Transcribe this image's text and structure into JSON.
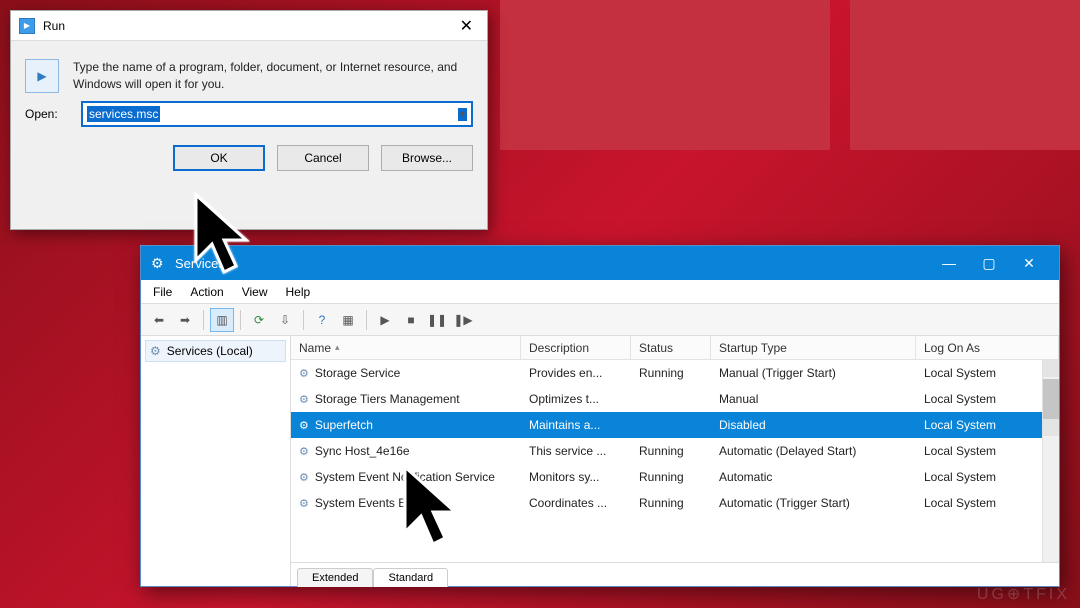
{
  "run": {
    "title": "Run",
    "instruction": "Type the name of a program, folder, document, or Internet resource, and Windows will open it for you.",
    "open_label": "Open:",
    "open_value": "services.msc",
    "ok": "OK",
    "cancel": "Cancel",
    "browse": "Browse..."
  },
  "services": {
    "title": "Services",
    "menu": {
      "file": "File",
      "action": "Action",
      "view": "View",
      "help": "Help"
    },
    "tree_root": "Services (Local)",
    "columns": {
      "name": "Name",
      "description": "Description",
      "status": "Status",
      "startup": "Startup Type",
      "logon": "Log On As"
    },
    "rows": [
      {
        "name": "Storage Service",
        "desc": "Provides en...",
        "status": "Running",
        "startup": "Manual (Trigger Start)",
        "logon": "Local System"
      },
      {
        "name": "Storage Tiers Management",
        "desc": "Optimizes t...",
        "status": "",
        "startup": "Manual",
        "logon": "Local System"
      },
      {
        "name": "Superfetch",
        "desc": "Maintains a...",
        "status": "",
        "startup": "Disabled",
        "logon": "Local System"
      },
      {
        "name": "Sync Host_4e16e",
        "desc": "This service ...",
        "status": "Running",
        "startup": "Automatic (Delayed Start)",
        "logon": "Local System"
      },
      {
        "name": "System Event Notification Service",
        "desc": "Monitors sy...",
        "status": "Running",
        "startup": "Automatic",
        "logon": "Local System"
      },
      {
        "name": "System Events Broker",
        "desc": "Coordinates ...",
        "status": "Running",
        "startup": "Automatic (Trigger Start)",
        "logon": "Local System"
      }
    ],
    "selected_index": 2,
    "tabs": {
      "extended": "Extended",
      "standard": "Standard",
      "active": "standard"
    }
  },
  "watermark": "UG⊕TFIX"
}
